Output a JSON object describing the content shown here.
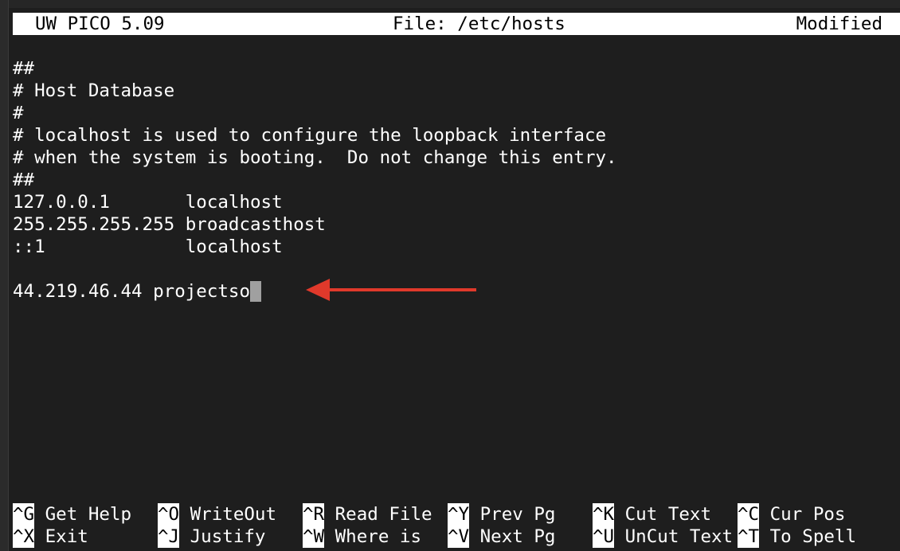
{
  "title_bar": {
    "app": "UW PICO 5.09",
    "file": "File: /etc/hosts",
    "status": "Modified"
  },
  "editor_lines": [
    "##",
    "# Host Database",
    "#",
    "# localhost is used to configure the loopback interface",
    "# when the system is booting.  Do not change this entry.",
    "##",
    "127.0.0.1       localhost",
    "255.255.255.255 broadcasthost",
    "::1             localhost",
    "",
    "44.219.46.44 projectso"
  ],
  "shortcuts": {
    "row1": [
      {
        "key": "^G",
        "label": "Get Help"
      },
      {
        "key": "^O",
        "label": "WriteOut"
      },
      {
        "key": "^R",
        "label": "Read File"
      },
      {
        "key": "^Y",
        "label": "Prev Pg"
      },
      {
        "key": "^K",
        "label": "Cut Text"
      },
      {
        "key": "^C",
        "label": "Cur Pos"
      }
    ],
    "row2": [
      {
        "key": "^X",
        "label": "Exit"
      },
      {
        "key": "^J",
        "label": "Justify"
      },
      {
        "key": "^W",
        "label": "Where is"
      },
      {
        "key": "^V",
        "label": "Next Pg"
      },
      {
        "key": "^U",
        "label": "UnCut Text"
      },
      {
        "key": "^T",
        "label": "To Spell"
      }
    ]
  },
  "colors": {
    "background": "#1e1e1e",
    "text": "#ffffff",
    "highlight": "#ffffff",
    "arrow": "#e0392b",
    "cursor": "#a0a0a0"
  },
  "icons": {
    "annotation": "red-arrow-icon"
  }
}
